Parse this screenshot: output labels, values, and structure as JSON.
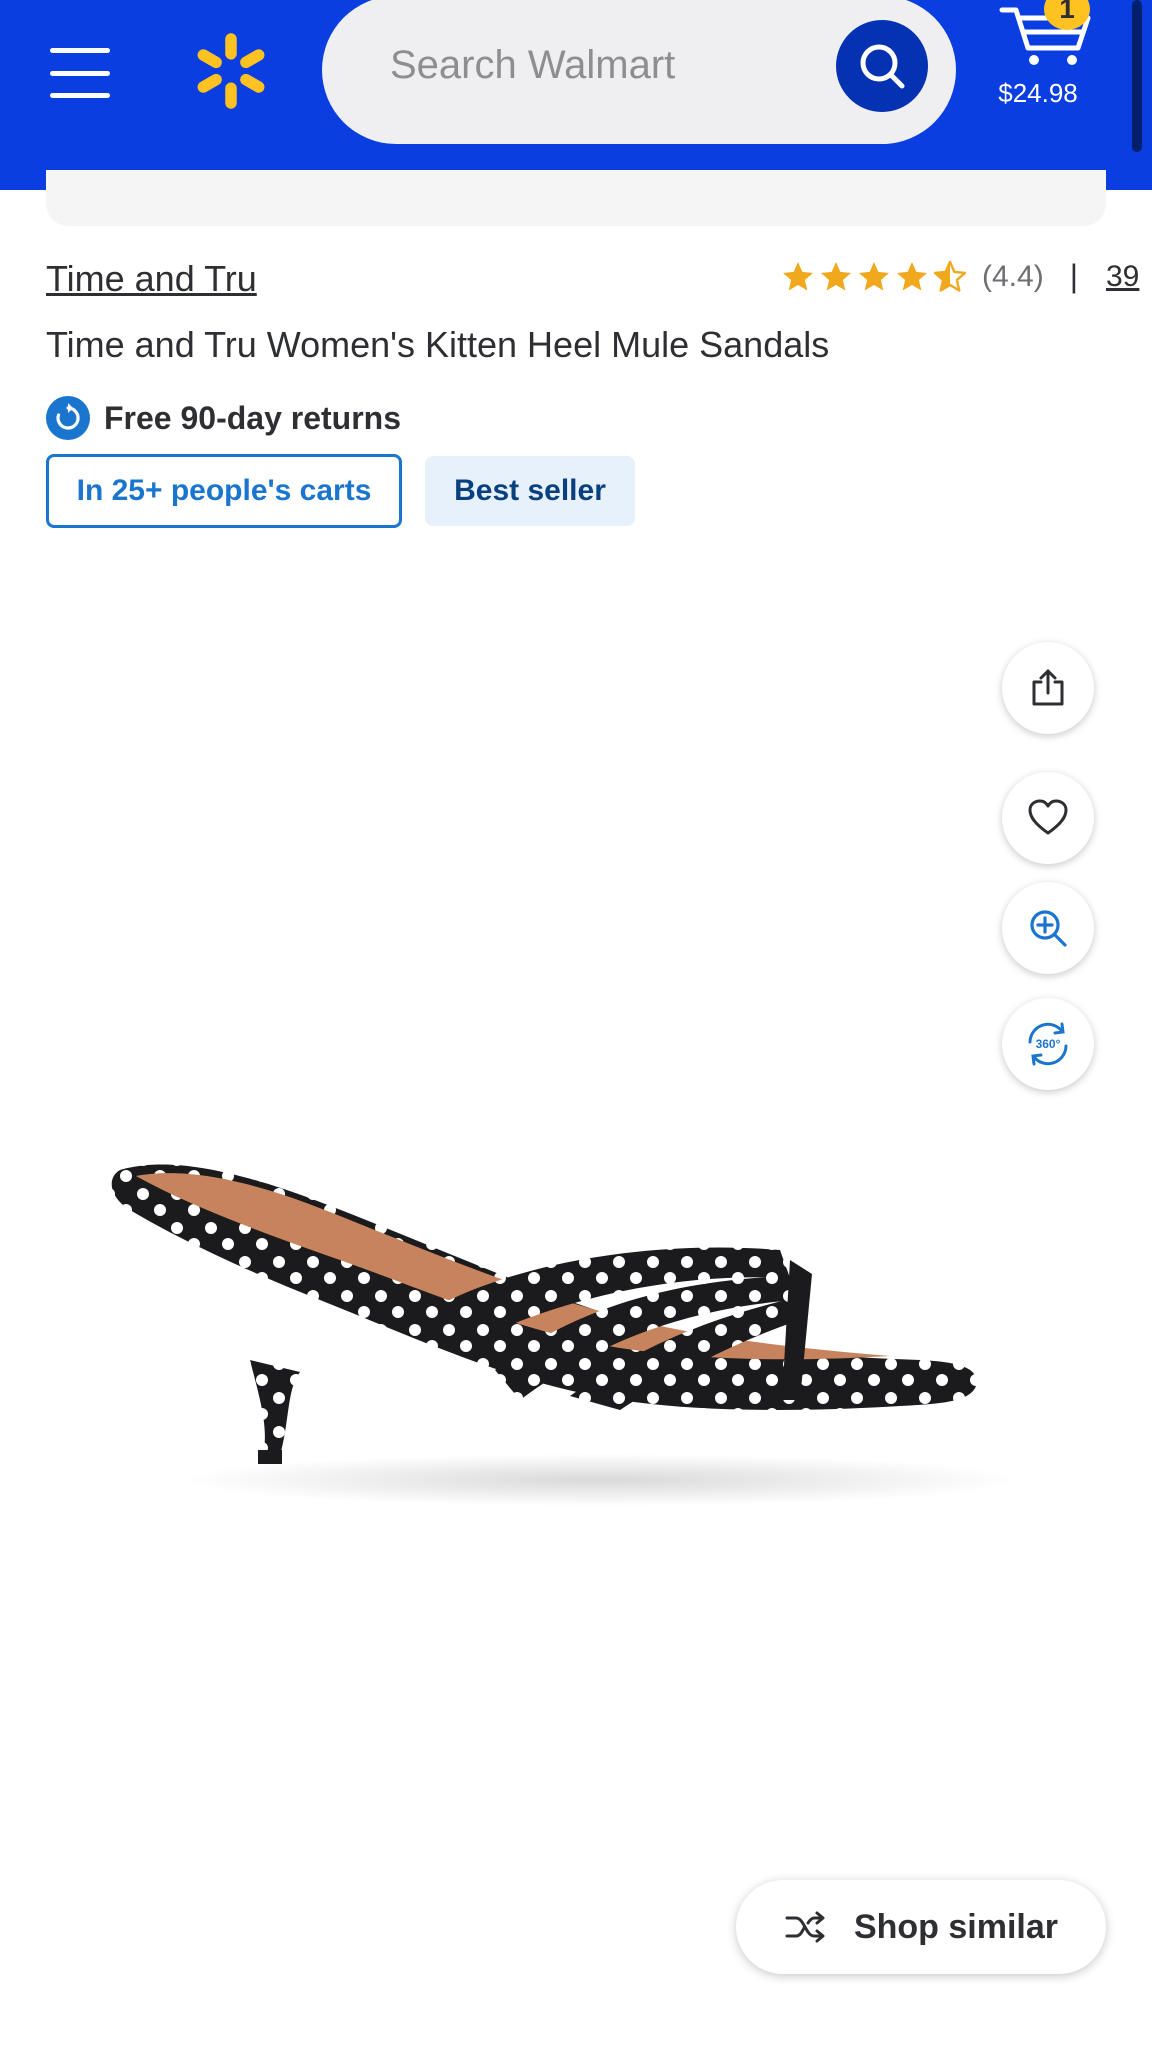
{
  "header": {
    "search_placeholder": "Search Walmart",
    "cart_count": "1",
    "cart_total": "$24.98"
  },
  "product": {
    "brand": "Time and Tru",
    "title": "Time and Tru Women's Kitten Heel Mule Sandals",
    "rating_value": "(4.4)",
    "rating_divider": "|",
    "rating": 4.4,
    "review_count": "39",
    "returns_text": "Free 90-day returns",
    "badges": {
      "carts": "In 25+ people's carts",
      "best_seller": "Best seller"
    },
    "color_pattern": "black with white polka dots"
  },
  "shop_similar_label": "Shop similar",
  "colors": {
    "header_blue": "#0a3ee0",
    "search_button": "#0432b3",
    "spark_yellow": "#ffc220",
    "badge_blue": "#1a75cf",
    "star_gold": "#f0a81c"
  },
  "icons": [
    "menu-icon",
    "walmart-spark-icon",
    "search-icon",
    "cart-icon",
    "star-icon",
    "returns-icon",
    "share-icon",
    "heart-icon",
    "zoom-in-icon",
    "view-360-icon",
    "shuffle-icon"
  ]
}
